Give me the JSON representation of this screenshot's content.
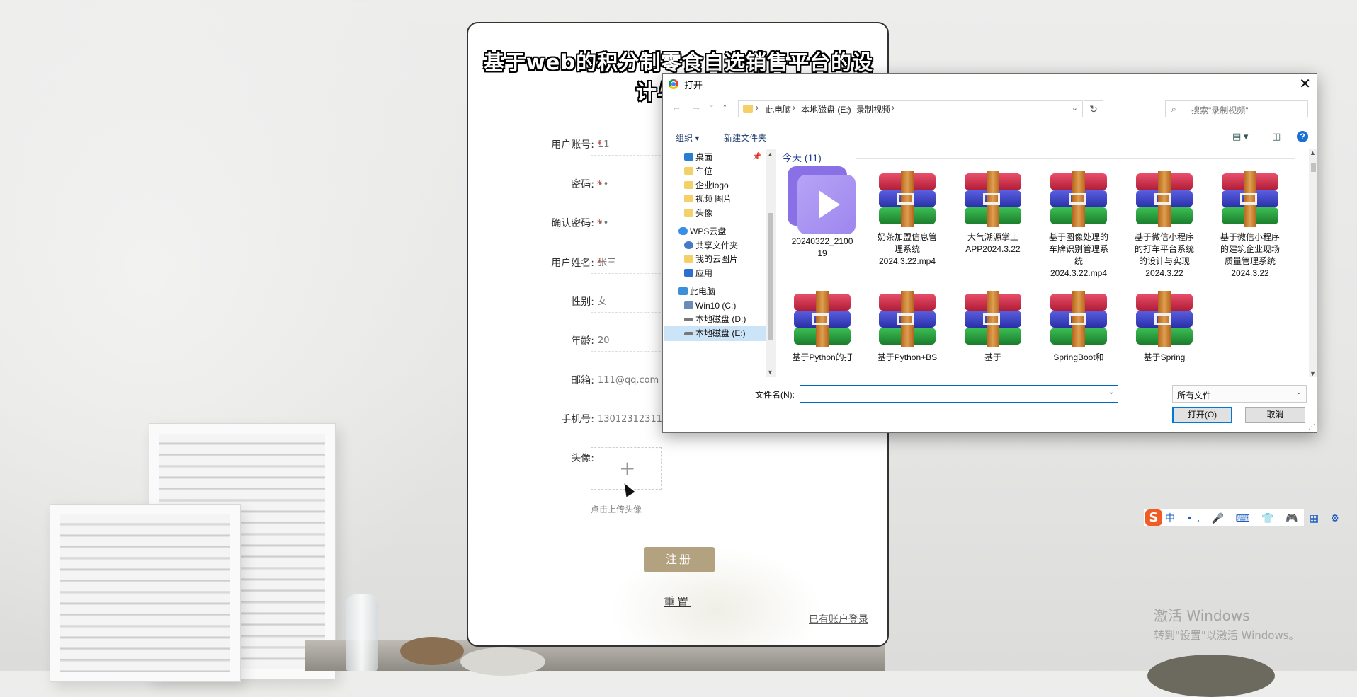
{
  "form": {
    "title": "基于web的积分制零食自选销售平台的设计与实现",
    "fields": [
      {
        "label": "用户账号:",
        "required": true,
        "value": "11"
      },
      {
        "label": "密码:",
        "required": true,
        "value": "••"
      },
      {
        "label": "确认密码:",
        "required": true,
        "value": "••"
      },
      {
        "label": "用户姓名:",
        "required": true,
        "value": "张三"
      },
      {
        "label": "性别:",
        "required": false,
        "value": "女"
      },
      {
        "label": "年龄:",
        "required": false,
        "value": "20"
      },
      {
        "label": "邮箱:",
        "required": false,
        "value": "111@qq.com"
      },
      {
        "label": "手机号:",
        "required": false,
        "value": "13012312311"
      }
    ],
    "avatar_label": "头像:",
    "required_mark": "*",
    "plus": "+",
    "upload_hint": "点击上传头像",
    "register_button": "注册",
    "reset_button": "重置",
    "login_link": "已有账户登录",
    "accent_color": "#b3a27f"
  },
  "dialog": {
    "title": "打开",
    "close": "✕",
    "nav_back": "←",
    "nav_forward": "→",
    "nav_recent": "⌄",
    "nav_up": "↑",
    "breadcrumbs": [
      "此电脑",
      "本地磁盘 (E:)",
      "录制视频"
    ],
    "crumb_sep": "›",
    "dropdown_arrow": "⌄",
    "refresh": "↻",
    "search_icon": "⌕",
    "search_placeholder": "搜索\"录制视频\"",
    "toolbar": {
      "organize": "组织 ▾",
      "new_folder": "新建文件夹",
      "view_icon": "▤ ▾",
      "preview_icon": "◫",
      "help": "?"
    },
    "nav_pane": [
      {
        "label": "桌面",
        "icon": "desktop-icon",
        "pinned": true
      },
      {
        "label": "车位",
        "icon": "folder-icon"
      },
      {
        "label": "企业logo",
        "icon": "folder-icon"
      },
      {
        "label": "视频 图片",
        "icon": "folder-icon"
      },
      {
        "label": "头像",
        "icon": "folder-icon"
      },
      {
        "label": "WPS云盘",
        "icon": "cloud-icon"
      },
      {
        "label": "共享文件夹",
        "icon": "share-icon"
      },
      {
        "label": "我的云图片",
        "icon": "folder-icon"
      },
      {
        "label": "应用",
        "icon": "apps-icon"
      },
      {
        "label": "此电脑",
        "icon": "pc-icon"
      },
      {
        "label": "Win10 (C:)",
        "icon": "drive-icon"
      },
      {
        "label": "本地磁盘 (D:)",
        "icon": "drive-icon"
      },
      {
        "label": "本地磁盘 (E:)",
        "icon": "drive-icon",
        "selected": true
      }
    ],
    "pin_icon": "📌",
    "scroll_up": "▲",
    "scroll_down": "▼",
    "group_header": "今天 (11)",
    "files": [
      {
        "name": "20240322_2100\n19",
        "type": "video"
      },
      {
        "name": "奶茶加盟信息管\n理系统\n2024.3.22.mp4",
        "type": "rar"
      },
      {
        "name": "大气溯源掌上\nAPP2024.3.22",
        "type": "rar"
      },
      {
        "name": "基于图像处理的\n车牌识别管理系\n统\n2024.3.22.mp4",
        "type": "rar"
      },
      {
        "name": "基于微信小程序\n的打车平台系统\n的设计与实现\n2024.3.22",
        "type": "rar"
      },
      {
        "name": "基于微信小程序\n的建筑企业现场\n质量管理系统\n2024.3.22",
        "type": "rar"
      },
      {
        "name": "基于Python的打",
        "type": "rar"
      },
      {
        "name": "基于Python+BS",
        "type": "rar"
      },
      {
        "name": "基于",
        "type": "rar"
      },
      {
        "name": "SpringBoot和",
        "type": "rar"
      },
      {
        "name": "基于Spring",
        "type": "rar"
      }
    ],
    "filename_label": "文件名(N):",
    "filename_value": "",
    "filter_value": "所有文件",
    "open_button": "打开(O)",
    "cancel_button": "取消",
    "grip": "⋰"
  },
  "ime": {
    "logo": "S",
    "items": "中 •, 🎤 ⌨ 👕 🎮 ▦ ⚙"
  },
  "activation": {
    "line1": "激活 Windows",
    "line2": "转到\"设置\"以激活 Windows。"
  }
}
